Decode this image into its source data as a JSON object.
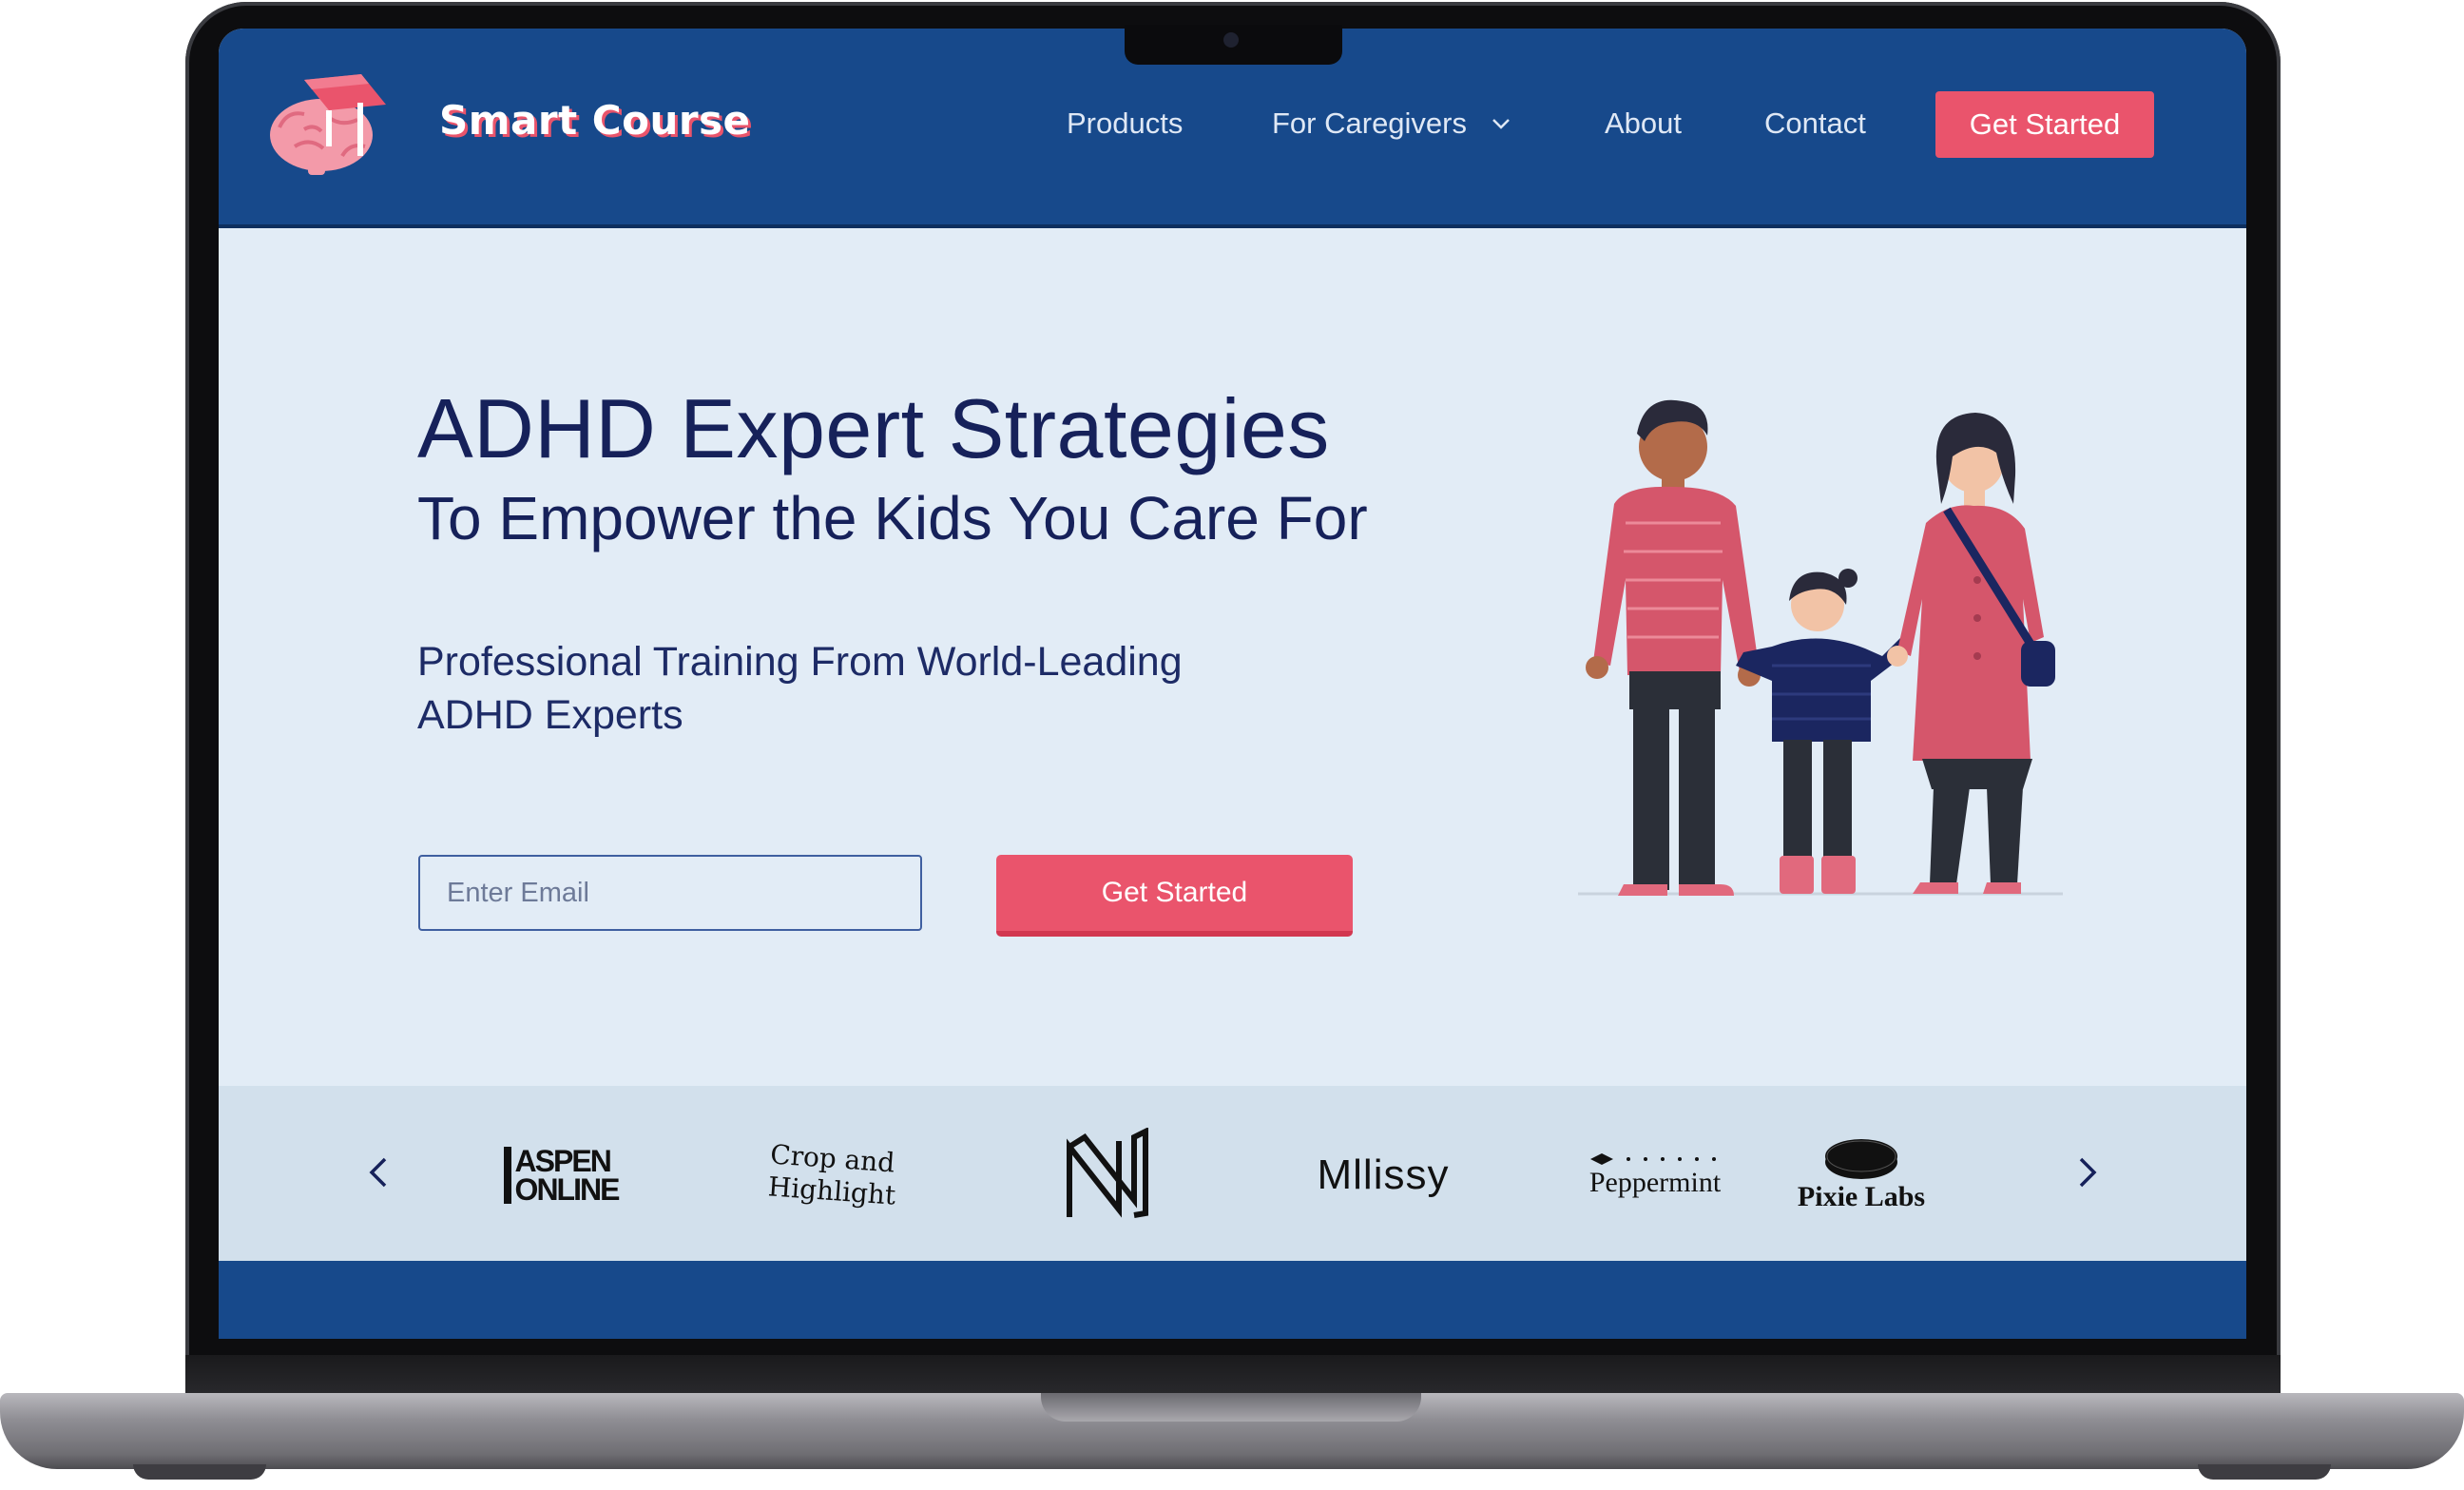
{
  "brand": {
    "name": "Smart Course",
    "logo_icon": "brain-graduation-cap-icon"
  },
  "nav": {
    "links": [
      "Products",
      "For Caregivers",
      "About",
      "Contact"
    ],
    "dropdown_icon": "chevron-down-icon",
    "cta_label": "Get Started"
  },
  "hero": {
    "title": "ADHD Expert Strategies",
    "subtitle": "To Empower the Kids You Care For",
    "description_line1": "Professional Training From World-Leading",
    "description_line2": "ADHD Experts",
    "email_placeholder": "Enter Email",
    "cta_label": "Get Started",
    "illustration": "family-illustration"
  },
  "partners": {
    "prev_icon": "chevron-left-icon",
    "next_icon": "chevron-right-icon",
    "logos": [
      {
        "line1": "ASPEN",
        "line2": "ONLINE"
      },
      {
        "line1": "Crop and",
        "line2": "Highlight"
      },
      {
        "icon": "n-monogram-logo"
      },
      {
        "text": "Mllissy"
      },
      {
        "text": "Peppermint"
      },
      {
        "text": "Pixie Labs"
      }
    ]
  },
  "colors": {
    "nav_bg": "#17498b",
    "accent": "#ea546c",
    "hero_bg": "#e2ecf6",
    "text_dark": "#16215a",
    "strip_bg": "#d2e0ec"
  }
}
